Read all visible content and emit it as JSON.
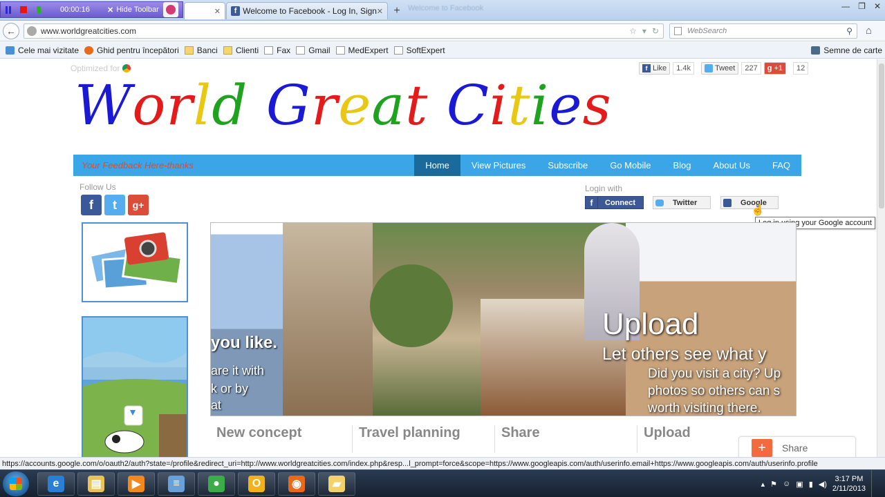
{
  "recorder": {
    "time": "00:00:16",
    "hide_label": "Hide Toolbar"
  },
  "tabs": [
    {
      "label": "",
      "active": true
    },
    {
      "label": "Welcome to Facebook - Log In, Sign ...",
      "active": false
    }
  ],
  "ghost_tabs": "Welcome to Facebook",
  "window_controls": {
    "minimize": "—",
    "restore": "❐",
    "close": "✕"
  },
  "nav": {
    "url": "www.worldgreatcities.com",
    "search_placeholder": "WebSearch"
  },
  "bookmarks": [
    {
      "label": "Cele mai vizitate",
      "icon": "star-icon"
    },
    {
      "label": "Ghid pentru începători",
      "icon": "firefox-icon"
    },
    {
      "label": "Banci",
      "icon": "folder-icon"
    },
    {
      "label": "Clienti",
      "icon": "folder-icon"
    },
    {
      "label": "Fax",
      "icon": "page-icon"
    },
    {
      "label": "Gmail",
      "icon": "page-icon"
    },
    {
      "label": "MedExpert",
      "icon": "page-icon"
    },
    {
      "label": "SoftExpert",
      "icon": "page-icon"
    }
  ],
  "bookmarks_right": "Semne de carte",
  "page": {
    "optimized_label": "Optimized for",
    "share": {
      "like_label": "Like",
      "like_count": "1.4k",
      "tweet_label": "Tweet",
      "tweet_count": "227",
      "gplus_label": "+1",
      "gplus_count": "12"
    },
    "logo_letters": [
      {
        "ch": "W",
        "color": "#1a1ad6"
      },
      {
        "ch": "o",
        "color": "#e31b1b"
      },
      {
        "ch": "r",
        "color": "#e31b1b"
      },
      {
        "ch": "l",
        "color": "#e8c812"
      },
      {
        "ch": "d",
        "color": "#1fa31f"
      },
      {
        "ch": " ",
        "color": "#000000"
      },
      {
        "ch": "G",
        "color": "#1a1ad6"
      },
      {
        "ch": "r",
        "color": "#e31b1b"
      },
      {
        "ch": "e",
        "color": "#e8c812"
      },
      {
        "ch": "a",
        "color": "#1fa31f"
      },
      {
        "ch": "t",
        "color": "#e31b1b"
      },
      {
        "ch": " ",
        "color": "#000000"
      },
      {
        "ch": "C",
        "color": "#1a1ad6"
      },
      {
        "ch": "i",
        "color": "#e31b1b"
      },
      {
        "ch": "t",
        "color": "#e8c812"
      },
      {
        "ch": "i",
        "color": "#1fa31f"
      },
      {
        "ch": "e",
        "color": "#1a1ad6"
      },
      {
        "ch": "s",
        "color": "#e31b1b"
      }
    ],
    "feedback": "Your Feedback Here-thanks",
    "menu": [
      {
        "label": "Home",
        "active": true
      },
      {
        "label": "View Pictures",
        "active": false
      },
      {
        "label": "Subscribe",
        "active": false
      },
      {
        "label": "Go Mobile",
        "active": false
      },
      {
        "label": "Blog",
        "active": false
      },
      {
        "label": "About Us",
        "active": false
      },
      {
        "label": "FAQ",
        "active": false
      }
    ],
    "follow_label": "Follow Us",
    "follow_icons": {
      "facebook": "f",
      "twitter": "t",
      "gplus": "g+"
    },
    "login_label": "Login with",
    "login_buttons": {
      "facebook": "Connect",
      "twitter": "Twitter",
      "google": "Google"
    },
    "tooltip": "Log in using your Google account",
    "hero": {
      "left_line1": "you like.",
      "left_line2": "are it with",
      "left_line3": "k or by",
      "left_line4": "at",
      "title": "Upload",
      "subtitle": "Let others see what y",
      "text_line1": "Did you visit a city? Up",
      "text_line2": "photos so others can s",
      "text_line3": "worth visiting there."
    },
    "features": [
      "New concept",
      "Travel planning",
      "Share",
      "Upload"
    ],
    "share_widget": {
      "plus": "+",
      "label": "Share"
    }
  },
  "status_url": "https://accounts.google.com/o/oauth2/auth?state=/profile&redirect_uri=http://www.worldgreatcities.com/index.php&resp...l_prompt=force&scope=https://www.googleapis.com/auth/userinfo.email+https://www.googleapis.com/auth/userinfo.profile",
  "taskbar": {
    "apps": [
      {
        "name": "ie",
        "glyph": "e",
        "color": "#2a7fd4"
      },
      {
        "name": "explorer",
        "glyph": "▤",
        "color": "#e8c35a"
      },
      {
        "name": "media",
        "glyph": "▶",
        "color": "#f08a1c"
      },
      {
        "name": "notepad",
        "glyph": "≡",
        "color": "#6aa0d8"
      },
      {
        "name": "chrome",
        "glyph": "●",
        "color": "#3cab4a"
      },
      {
        "name": "outlook",
        "glyph": "O",
        "color": "#f3b21b"
      },
      {
        "name": "firefox",
        "glyph": "◉",
        "color": "#e66a1a"
      },
      {
        "name": "folder",
        "glyph": "▰",
        "color": "#f1d36a"
      }
    ],
    "time": "3:17 PM",
    "date": "2/11/2013"
  }
}
